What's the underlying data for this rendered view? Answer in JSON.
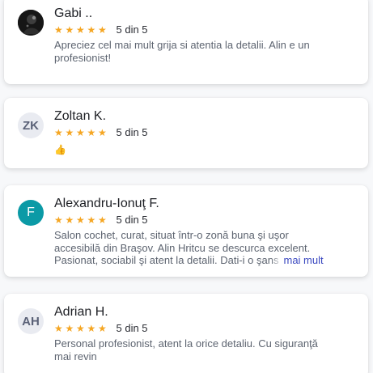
{
  "accent_star_color": "#f5a623",
  "link_color": "#3a48c0",
  "reviews": [
    {
      "name": "Gabi ..",
      "avatar": {
        "type": "photo",
        "icon": "user-photo"
      },
      "stars": 5,
      "score_label": "5 din 5",
      "text_lines": [
        "Apreciez cel mai mult grija si atentia la detalii. Alin e un",
        "profesionist!"
      ]
    },
    {
      "name": "Zoltan K.",
      "avatar": {
        "type": "initials",
        "initials": "ZK"
      },
      "stars": 5,
      "score_label": "5 din 5",
      "emoji": "👍"
    },
    {
      "name": "Alexandru-Ionuţ F.",
      "avatar": {
        "type": "initials",
        "initials": "F",
        "color": "#0b9aa6"
      },
      "stars": 5,
      "score_label": "5 din 5",
      "text_lines": [
        "Salon cochet, curat, situat într-o zonă buna şi uşor",
        "accesibilă din Braşov. Alin Hritcu se descurca excelent.",
        "Pasionat, sociabil şi atent la detalii. Dati-i o şans"
      ],
      "more_label": "mai mult"
    },
    {
      "name": "Adrian H.",
      "avatar": {
        "type": "initials",
        "initials": "AH"
      },
      "stars": 5,
      "score_label": "5 din 5",
      "text_lines": [
        "Personal profesionist, atent la orice detaliu. Cu siguranţă",
        "mai revin"
      ]
    }
  ]
}
